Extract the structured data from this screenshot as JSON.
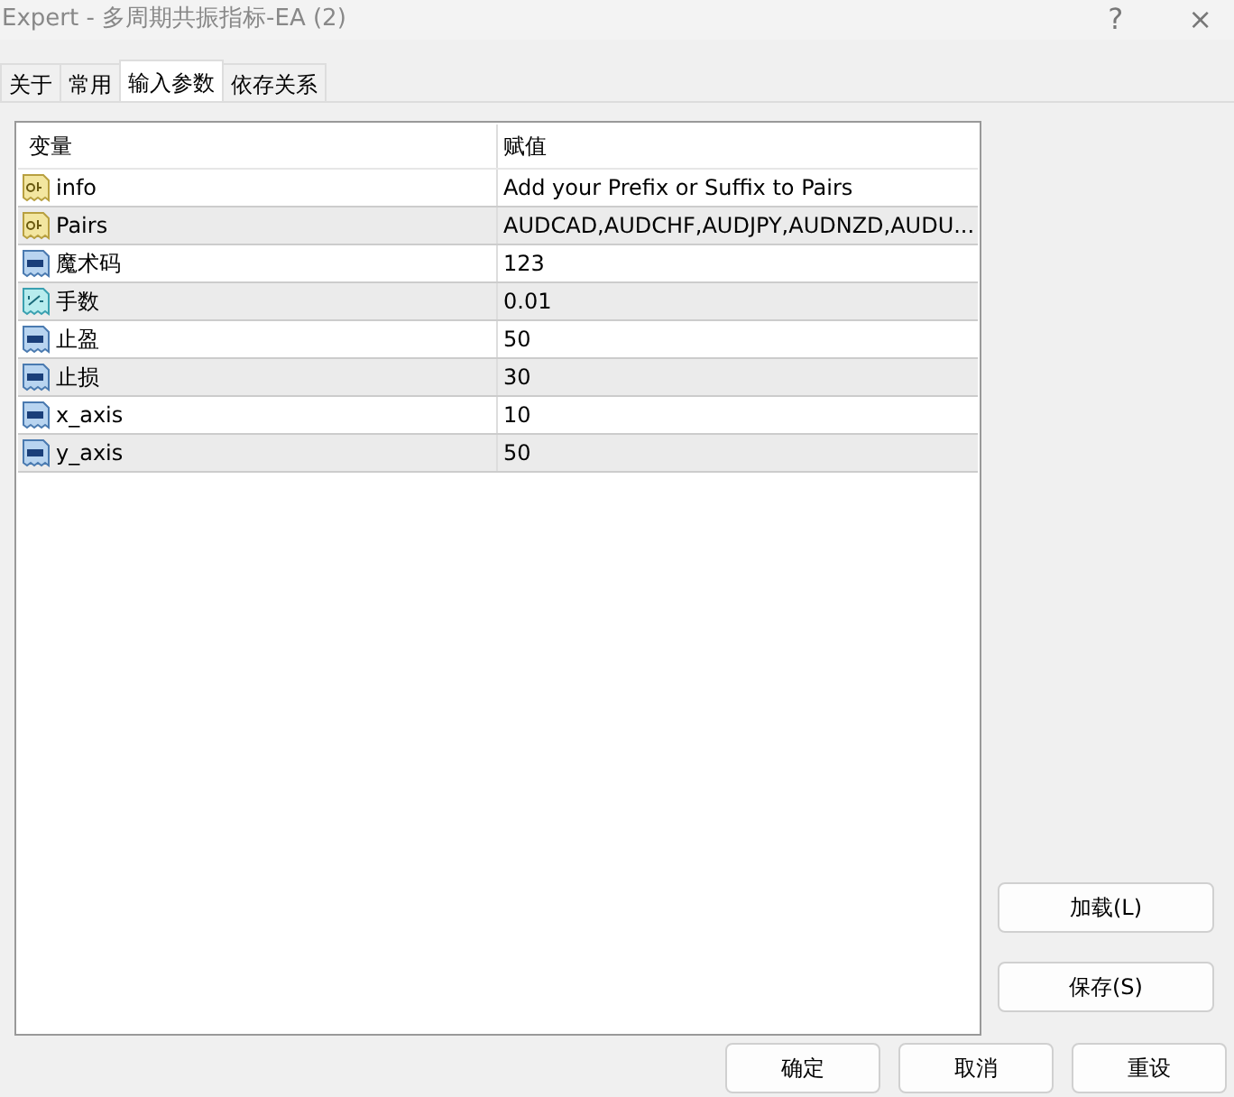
{
  "window": {
    "title": "Expert - 多周期共振指标-EA (2)",
    "help": "?",
    "close": "×"
  },
  "tabs": [
    {
      "label": "关于",
      "selected": false
    },
    {
      "label": "常用",
      "selected": false
    },
    {
      "label": "输入参数",
      "selected": true
    },
    {
      "label": "依存关系",
      "selected": false
    }
  ],
  "table": {
    "columns": [
      "变量",
      "赋值"
    ],
    "rows": [
      {
        "kind": "string",
        "name": "info",
        "value": "Add your Prefix or Suffix to Pairs"
      },
      {
        "kind": "string",
        "name": "Pairs",
        "value": "AUDCAD,AUDCHF,AUDJPY,AUDNZD,AUDU..."
      },
      {
        "kind": "int",
        "name": "魔术码",
        "value": "123"
      },
      {
        "kind": "double",
        "name": "手数",
        "value": "0.01"
      },
      {
        "kind": "int",
        "name": "止盈",
        "value": "50"
      },
      {
        "kind": "int",
        "name": "止损",
        "value": "30"
      },
      {
        "kind": "int",
        "name": "x_axis",
        "value": "10"
      },
      {
        "kind": "int",
        "name": "y_axis",
        "value": "50"
      }
    ]
  },
  "side_buttons": [
    "加载(L)",
    "保存(S)"
  ],
  "buttons": [
    "确定",
    "取消",
    "重设"
  ]
}
